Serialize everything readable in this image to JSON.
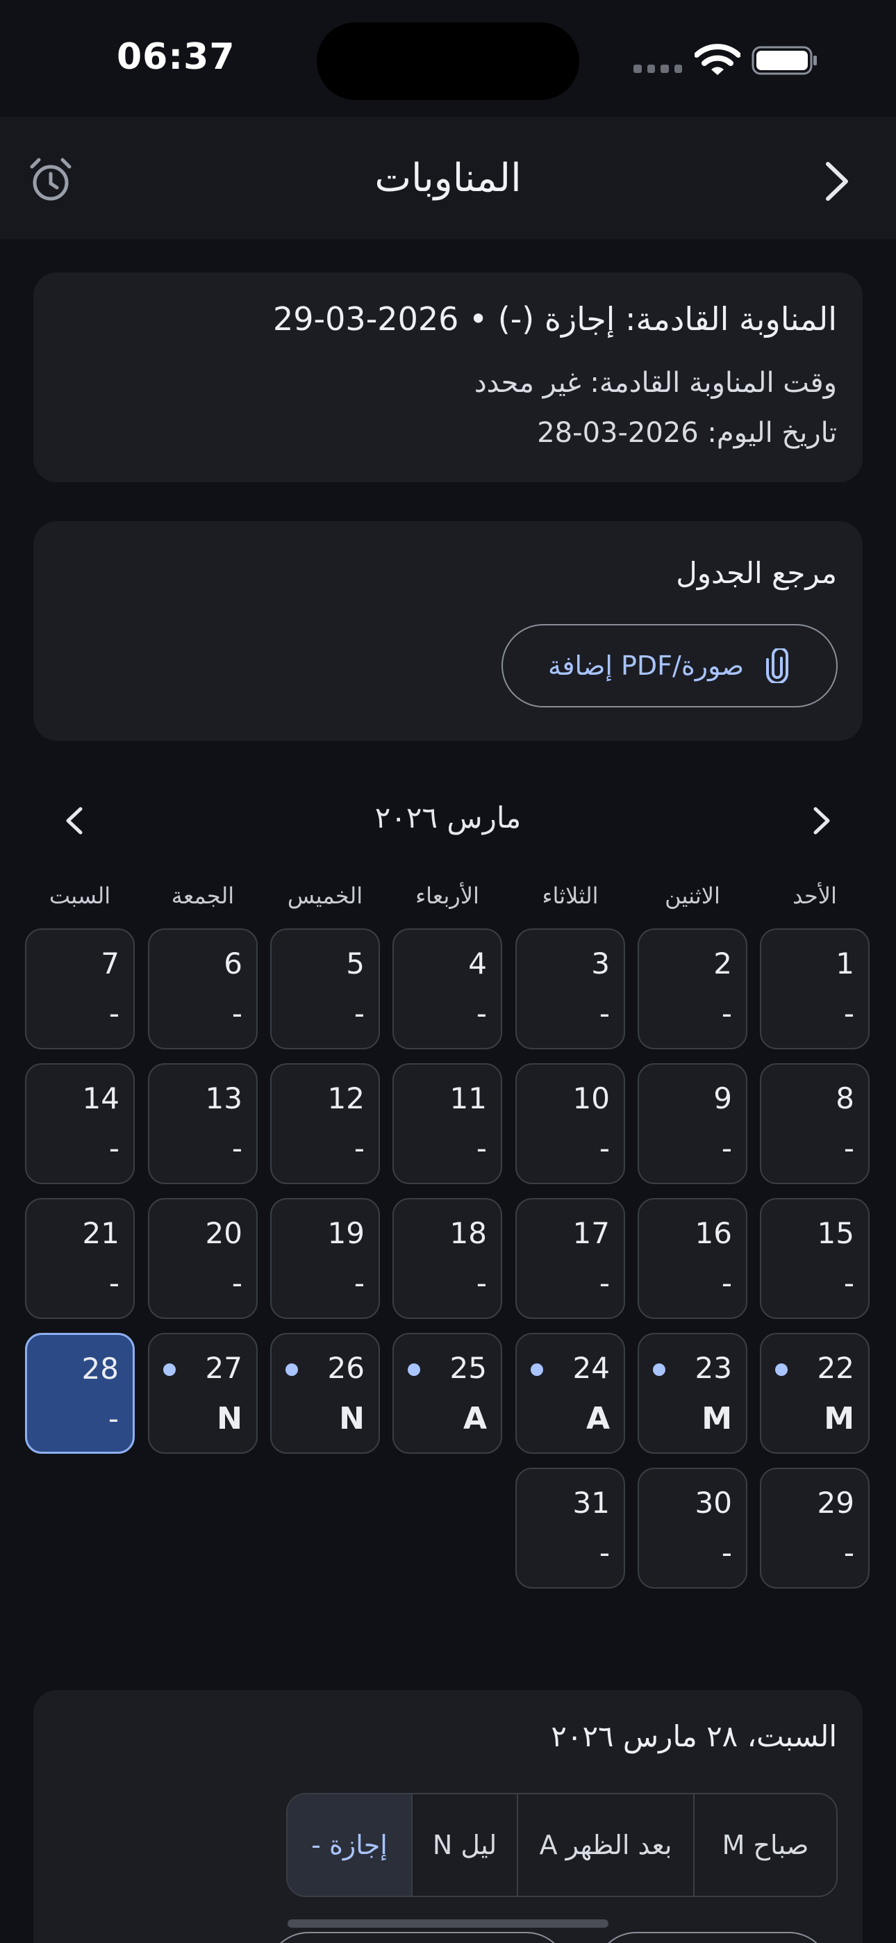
{
  "status_bar": {
    "time": "06:37"
  },
  "nav": {
    "title": "المناوبات"
  },
  "summary": {
    "next_shift": "المناوبة القادمة: إجازة (-) • 2026-03-29",
    "next_time": "وقت المناوبة القادمة: غير محدد",
    "today": "تاريخ اليوم: 2026-03-28"
  },
  "reference": {
    "title": "مرجع الجدول",
    "add_button": "إضافة PDF/صورة"
  },
  "calendar": {
    "month_label": "مارس ٢٠٢٦",
    "weekdays": [
      "الأحد",
      "الاثنين",
      "الثلاثاء",
      "الأربعاء",
      "الخميس",
      "الجمعة",
      "السبت"
    ],
    "days": [
      {
        "n": "1",
        "code": "-"
      },
      {
        "n": "2",
        "code": "-"
      },
      {
        "n": "3",
        "code": "-"
      },
      {
        "n": "4",
        "code": "-"
      },
      {
        "n": "5",
        "code": "-"
      },
      {
        "n": "6",
        "code": "-"
      },
      {
        "n": "7",
        "code": "-"
      },
      {
        "n": "8",
        "code": "-"
      },
      {
        "n": "9",
        "code": "-"
      },
      {
        "n": "10",
        "code": "-"
      },
      {
        "n": "11",
        "code": "-"
      },
      {
        "n": "12",
        "code": "-"
      },
      {
        "n": "13",
        "code": "-"
      },
      {
        "n": "14",
        "code": "-"
      },
      {
        "n": "15",
        "code": "-"
      },
      {
        "n": "16",
        "code": "-"
      },
      {
        "n": "17",
        "code": "-"
      },
      {
        "n": "18",
        "code": "-"
      },
      {
        "n": "19",
        "code": "-"
      },
      {
        "n": "20",
        "code": "-"
      },
      {
        "n": "21",
        "code": "-"
      },
      {
        "n": "22",
        "code": "M",
        "dot": true
      },
      {
        "n": "23",
        "code": "M",
        "dot": true
      },
      {
        "n": "24",
        "code": "A",
        "dot": true
      },
      {
        "n": "25",
        "code": "A",
        "dot": true
      },
      {
        "n": "26",
        "code": "N",
        "dot": true
      },
      {
        "n": "27",
        "code": "N",
        "dot": true
      },
      {
        "n": "28",
        "code": "-",
        "selected": true
      },
      {
        "n": "29",
        "code": "-"
      },
      {
        "n": "30",
        "code": "-"
      },
      {
        "n": "31",
        "code": "-"
      }
    ]
  },
  "detail": {
    "date": "السبت، ٢٨ مارس ٢٠٢٦",
    "options": [
      "M صباح",
      "A بعد الظهر",
      "N ليل",
      "- إجازة"
    ],
    "selected_option": "- إجازة"
  },
  "colors": {
    "accent": "#a9c4ff",
    "selected_day": "#2c4a86",
    "card": "#1b1d23",
    "background": "#0f1116"
  }
}
